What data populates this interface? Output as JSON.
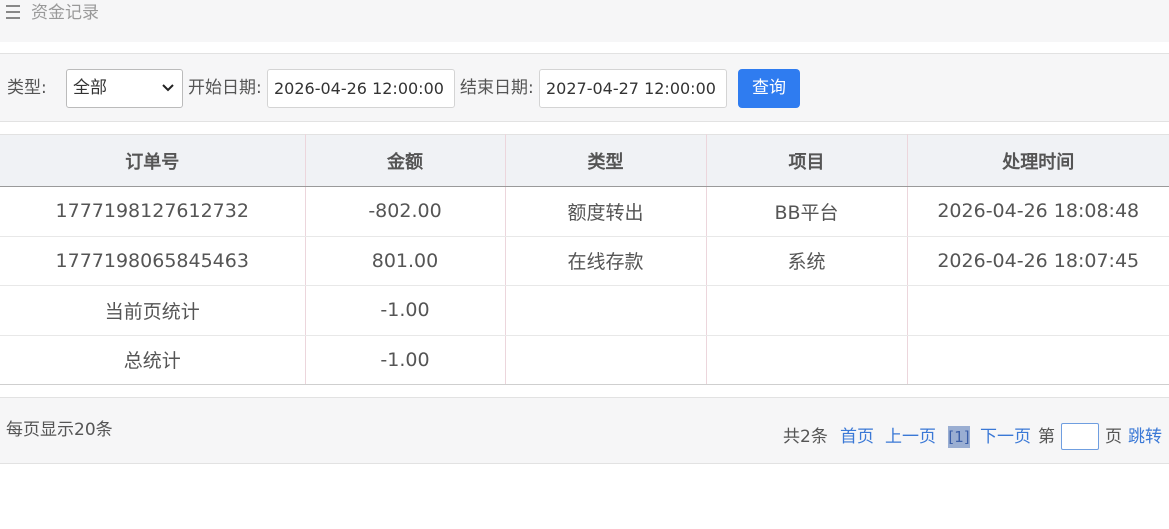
{
  "header": {
    "title": "资金记录",
    "menu_icon": "hamburger-icon"
  },
  "filter": {
    "type_label": "类型:",
    "type_value": "全部",
    "start_label": "开始日期:",
    "start_value": "2026-04-26 12:00:00",
    "end_label": "结束日期:",
    "end_value": "2027-04-27 12:00:00",
    "query_label": "查询"
  },
  "table": {
    "columns": [
      "订单号",
      "金额",
      "类型",
      "项目",
      "处理时间"
    ],
    "rows": [
      [
        "1777198127612732",
        "-802.00",
        "额度转出",
        "BB平台",
        "2026-04-26 18:08:48"
      ],
      [
        "1777198065845463",
        "801.00",
        "在线存款",
        "系统",
        "2026-04-26 18:07:45"
      ],
      [
        "当前页统计",
        "-1.00",
        "",
        "",
        ""
      ],
      [
        "总统计",
        "-1.00",
        "",
        "",
        ""
      ]
    ]
  },
  "footer": {
    "per_page": "每页显示20条",
    "total": "共2条",
    "first": "首页",
    "prev": "上一页",
    "current": "[1]",
    "next": "下一页",
    "page_prefix": "第",
    "page_suffix": "页",
    "jump": "跳转"
  },
  "colors": {
    "accent": "#2f7cf0",
    "link": "#3a78d6",
    "current_page_bg": "#9aaed2"
  }
}
